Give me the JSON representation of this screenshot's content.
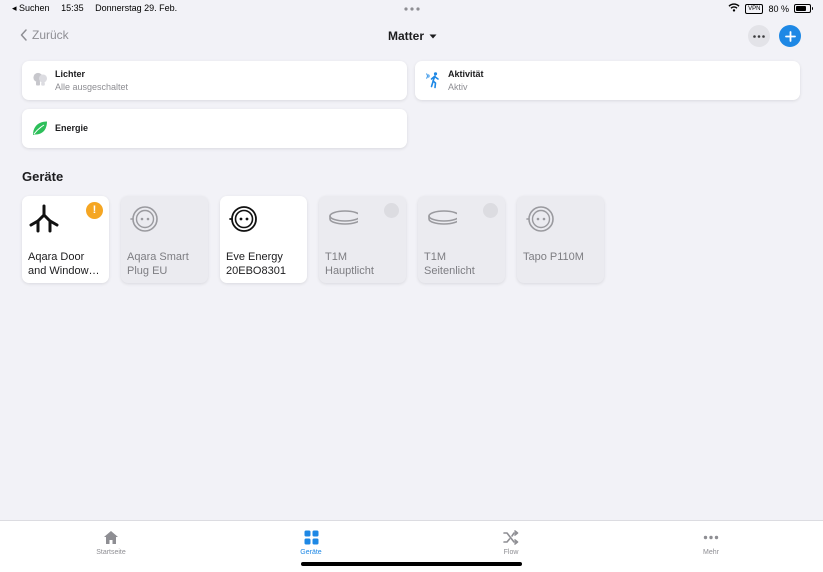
{
  "status_bar": {
    "back_app": "◂ Suchen",
    "time": "15:35",
    "date": "Donnerstag 29. Feb.",
    "vpn": "VPN",
    "battery": "80 %"
  },
  "nav": {
    "back_label": "Zurück",
    "title": "Matter"
  },
  "summary": {
    "lights": {
      "title": "Lichter",
      "subtitle": "Alle ausgeschaltet"
    },
    "activity": {
      "title": "Aktivität",
      "subtitle": "Aktiv"
    },
    "energy": {
      "title": "Energie"
    }
  },
  "devices_section": {
    "title": "Geräte"
  },
  "devices": [
    {
      "line1": "Aqara Door",
      "line2": "and Window…",
      "icon": "matter-logo-icon",
      "state": "on",
      "badge": "!"
    },
    {
      "line1": "Aqara Smart",
      "line2": "Plug EU",
      "icon": "plug-icon",
      "state": "off"
    },
    {
      "line1": "Eve Energy",
      "line2": "20EBO8301",
      "icon": "plug-icon",
      "state": "on"
    },
    {
      "line1": "T1M",
      "line2": "Hauptlicht",
      "icon": "ceiling-light-icon",
      "state": "off"
    },
    {
      "line1": "T1M",
      "line2": "Seitenlicht",
      "icon": "ceiling-light-icon",
      "state": "off"
    },
    {
      "line1": "Tapo P110M",
      "line2": "",
      "icon": "plug-icon",
      "state": "off"
    }
  ],
  "tabs": [
    {
      "label": "Startseite",
      "icon": "home-icon"
    },
    {
      "label": "Geräte",
      "icon": "grid-icon",
      "active": true
    },
    {
      "label": "Flow",
      "icon": "shuffle-icon"
    },
    {
      "label": "Mehr",
      "icon": "more-dots-icon"
    }
  ],
  "colors": {
    "accent": "#1e88e5",
    "warning": "#f5a623",
    "energy_green": "#2dbf5a",
    "background": "#f2f2f7"
  }
}
